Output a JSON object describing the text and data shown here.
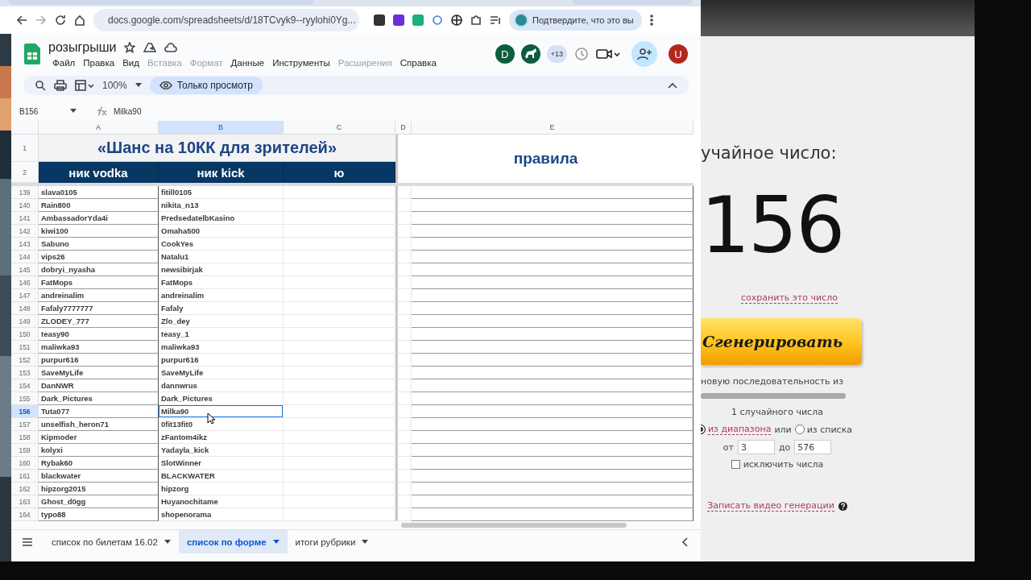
{
  "browser": {
    "url": "docs.google.com/spreadsheets/d/18TCvyk9--ryylohi0Yg...",
    "profile_prompt": "Подтвердите, что это вы"
  },
  "sheet": {
    "title": "розыгрыши",
    "menu": [
      {
        "label": "Файл",
        "disabled": false
      },
      {
        "label": "Правка",
        "disabled": false
      },
      {
        "label": "Вид",
        "disabled": false
      },
      {
        "label": "Вставка",
        "disabled": true
      },
      {
        "label": "Формат",
        "disabled": true
      },
      {
        "label": "Данные",
        "disabled": false
      },
      {
        "label": "Инструменты",
        "disabled": false
      },
      {
        "label": "Расширения",
        "disabled": true
      },
      {
        "label": "Справка",
        "disabled": false
      }
    ],
    "avatar_initial": "D",
    "more_count": "+13",
    "user_initial": "U",
    "zoom": "100%",
    "mode": "Только просмотр",
    "cell_ref": "B156",
    "formula": "Milka90",
    "columns": [
      {
        "label": "A",
        "selected": false
      },
      {
        "label": "B",
        "selected": true
      },
      {
        "label": "C",
        "selected": false
      },
      {
        "label": "D",
        "selected": false
      },
      {
        "label": "E",
        "selected": false
      }
    ],
    "title_row": {
      "number": "1",
      "text": "«Шанс на 10КК для зрителей»"
    },
    "header_row": {
      "number": "2",
      "cells": [
        "ник vodka",
        "ник kick",
        "ю"
      ]
    },
    "rules": "правила",
    "rows": [
      {
        "number": "139",
        "cells": [
          "slava0105",
          "fitill0105"
        ],
        "selected": false
      },
      {
        "number": "140",
        "cells": [
          "Rain800",
          "nikita_n13"
        ],
        "selected": false
      },
      {
        "number": "141",
        "cells": [
          "AmbassadorYda4i",
          "PredsedatelbKasino"
        ],
        "selected": false
      },
      {
        "number": "142",
        "cells": [
          "kiwi100",
          "Omaha500"
        ],
        "selected": false
      },
      {
        "number": "143",
        "cells": [
          "Sabuno",
          "CookYes"
        ],
        "selected": false
      },
      {
        "number": "144",
        "cells": [
          "vips26",
          "Natalu1"
        ],
        "selected": false
      },
      {
        "number": "145",
        "cells": [
          "dobryi_nyasha",
          "newsibirjak"
        ],
        "selected": false
      },
      {
        "number": "146",
        "cells": [
          "FatMops",
          "FatMops"
        ],
        "selected": false
      },
      {
        "number": "147",
        "cells": [
          "andreinalim",
          "andreinalim"
        ],
        "selected": false
      },
      {
        "number": "148",
        "cells": [
          "Fafaly7777777",
          "Fafaly"
        ],
        "selected": false
      },
      {
        "number": "149",
        "cells": [
          "ZLODEY_777",
          "Zlo_dey"
        ],
        "selected": false
      },
      {
        "number": "150",
        "cells": [
          "teasy90",
          "teasy_1"
        ],
        "selected": false
      },
      {
        "number": "151",
        "cells": [
          "maliwka93",
          "maliwka93"
        ],
        "selected": false
      },
      {
        "number": "152",
        "cells": [
          "purpur616",
          "purpur616"
        ],
        "selected": false
      },
      {
        "number": "153",
        "cells": [
          "SaveMyLife",
          "SaveMyLife"
        ],
        "selected": false
      },
      {
        "number": "154",
        "cells": [
          "DanNWR",
          "dannwrus"
        ],
        "selected": false
      },
      {
        "number": "155",
        "cells": [
          "Dark_Pictures",
          "Dark_Pictures"
        ],
        "selected": false
      },
      {
        "number": "156",
        "cells": [
          "Tuta077",
          "Milka90"
        ],
        "selected": true
      },
      {
        "number": "157",
        "cells": [
          "unselfish_heron71",
          "0fit13fit0"
        ],
        "selected": false
      },
      {
        "number": "158",
        "cells": [
          "Kipmoder",
          "zFantom4ikz"
        ],
        "selected": false
      },
      {
        "number": "159",
        "cells": [
          "kolyxi",
          "Yadayla_kick"
        ],
        "selected": false
      },
      {
        "number": "160",
        "cells": [
          "Rybak60",
          "SlotWinner"
        ],
        "selected": false
      },
      {
        "number": "161",
        "cells": [
          "blackwater",
          "BLACKWATER"
        ],
        "selected": false
      },
      {
        "number": "162",
        "cells": [
          "hipzorg2015",
          "hipzorg"
        ],
        "selected": false
      },
      {
        "number": "163",
        "cells": [
          "Ghost_d0gg",
          "Huyanochitame"
        ],
        "selected": false
      },
      {
        "number": "164",
        "cells": [
          "typo88",
          "shopenorama"
        ],
        "selected": false
      }
    ],
    "sheet_tabs": [
      {
        "label": "список по билетам 16.02",
        "selected": false
      },
      {
        "label": "список по форме",
        "selected": true
      },
      {
        "label": "итоги рубрики",
        "selected": false
      }
    ]
  },
  "generator": {
    "heading": "учайное число:",
    "number": "156",
    "save_link": "сохранить это число",
    "button": "Сгенерировать",
    "sequence_text": "новую последовательность из",
    "count_text": "1 случайного числа",
    "range_options": [
      {
        "label": "из диапазона",
        "selected": true
      },
      {
        "label": "из списка",
        "selected": false
      }
    ],
    "or_text": "или",
    "from_label": "от",
    "from_value": "3",
    "to_label": "до",
    "to_value": "576",
    "exclude": {
      "label": "исключить числа",
      "checked": false
    },
    "video_link": "Записать видео генерации"
  }
}
